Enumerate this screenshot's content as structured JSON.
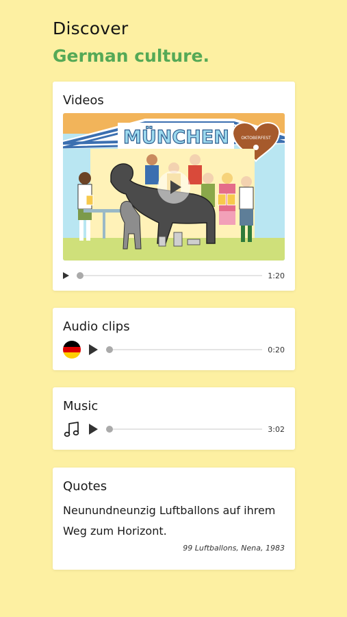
{
  "header": {
    "title": "Discover",
    "subtitle": "German culture."
  },
  "videos": {
    "title": "Videos",
    "thumbnail_sign": "MÜNCHEN",
    "heart_text": "OKTOBERFEST",
    "time": "1:20",
    "progress": 0
  },
  "audio": {
    "title": "Audio clips",
    "flag_icon": "germany-flag-icon",
    "time": "0:20",
    "progress": 0
  },
  "music": {
    "title": "Music",
    "note_icon": "music-note-icon",
    "time": "3:02",
    "progress": 0
  },
  "quotes": {
    "title": "Quotes",
    "text": "Neunundneunzig Luftballons auf ihrem Weg zum Horizont.",
    "source": "99 Luftballons, Nena, 1983"
  },
  "colors": {
    "background": "#FDF0A2",
    "accent_green": "#55A956",
    "flag_black": "#000000",
    "flag_red": "#DD0000",
    "flag_gold": "#FFCE00"
  }
}
